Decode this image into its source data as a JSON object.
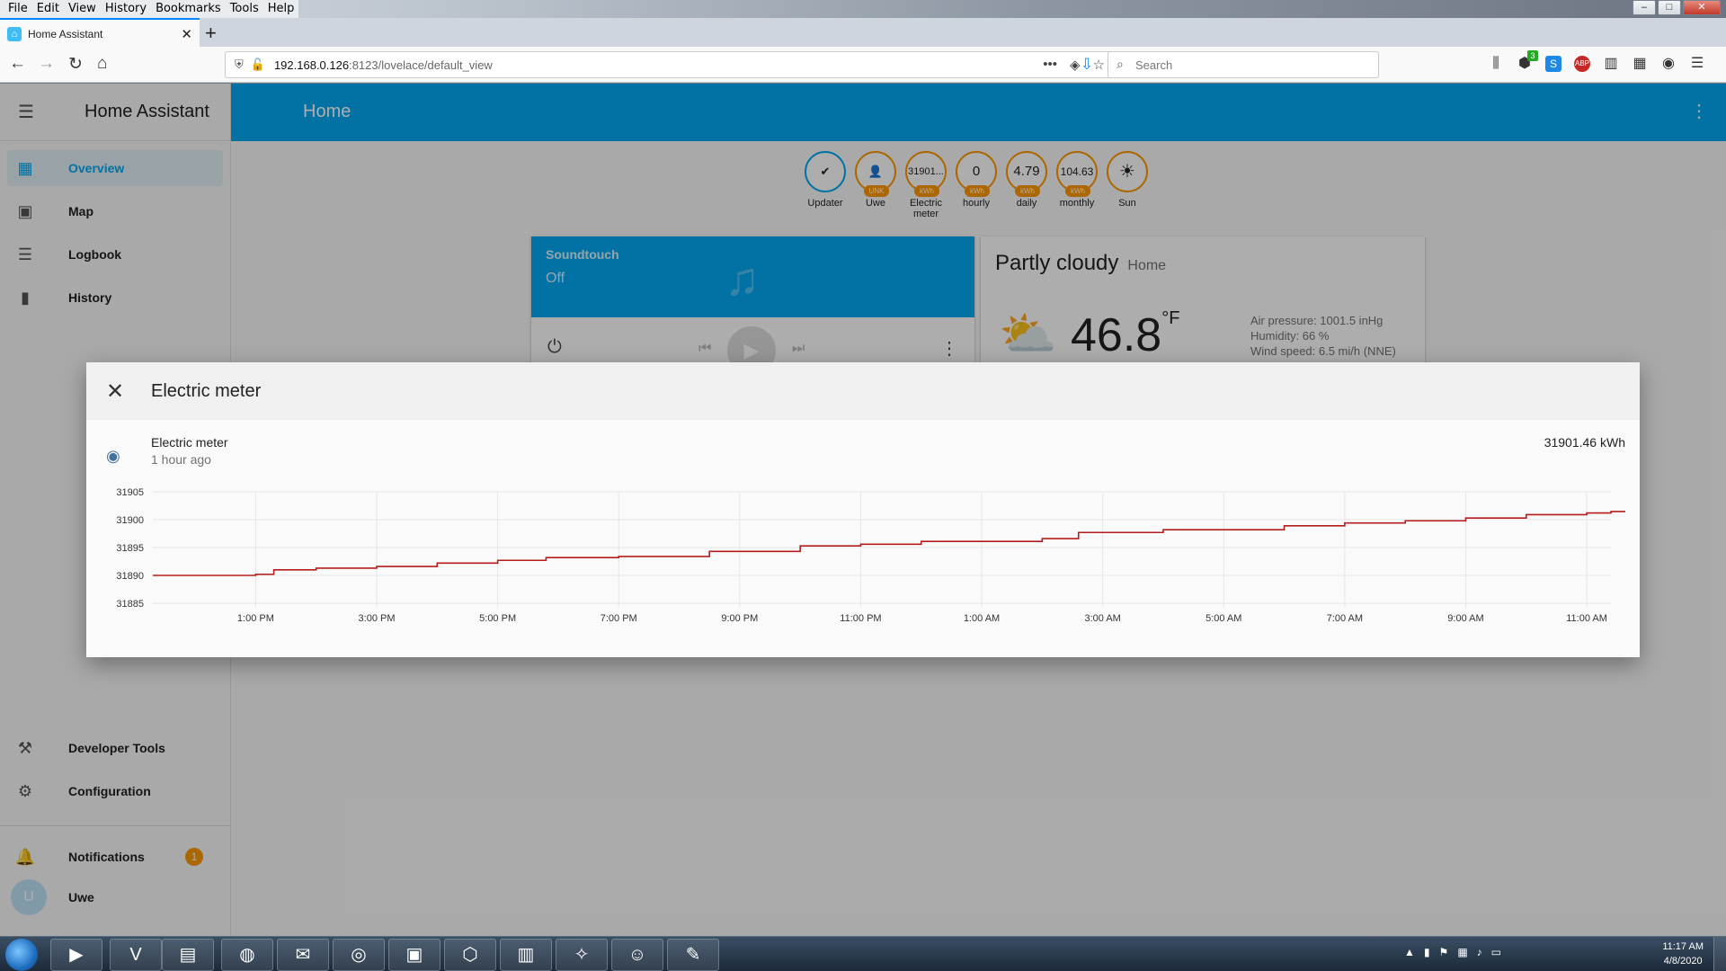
{
  "browser": {
    "menu": [
      "File",
      "Edit",
      "View",
      "History",
      "Bookmarks",
      "Tools",
      "Help"
    ],
    "tab_title": "Home Assistant",
    "url_host": "192.168.0.126",
    "url_path": ":8123/lovelace/default_view",
    "search_placeholder": "Search",
    "toolbar_badge": "3"
  },
  "sidebar": {
    "title": "Home Assistant",
    "items": [
      {
        "label": "Overview",
        "icon": "grid-icon"
      },
      {
        "label": "Map",
        "icon": "map-icon"
      },
      {
        "label": "Logbook",
        "icon": "list-icon"
      },
      {
        "label": "History",
        "icon": "chart-icon"
      }
    ],
    "bottom": [
      {
        "label": "Developer Tools",
        "icon": "hammer-icon"
      },
      {
        "label": "Configuration",
        "icon": "gear-icon"
      }
    ],
    "notifications": {
      "label": "Notifications",
      "count": "1"
    },
    "user": {
      "initial": "U",
      "name": "Uwe"
    }
  },
  "header": {
    "title": "Home"
  },
  "badges": [
    {
      "value": "✔",
      "unit": "",
      "label": "Updater"
    },
    {
      "value": "👤",
      "unit": "UNK",
      "label": "Uwe"
    },
    {
      "value": "31901...",
      "unit": "kWh",
      "label": "Electric meter"
    },
    {
      "value": "0",
      "unit": "kWh",
      "label": "hourly"
    },
    {
      "value": "4.79",
      "unit": "kWh",
      "label": "daily"
    },
    {
      "value": "104.63",
      "unit": "kWh",
      "label": "monthly"
    },
    {
      "value": "☀",
      "unit": "",
      "label": "Sun"
    }
  ],
  "media": {
    "name": "Soundtouch",
    "state": "Off"
  },
  "weather": {
    "condition": "Partly cloudy",
    "location": "Home",
    "temp": "46.8",
    "unit": "°F",
    "pressure": "Air pressure: 1001.5 inHg",
    "humidity": "Humidity: 66 %",
    "wind": "Wind speed: 6.5 mi/h (NNE)"
  },
  "dialog": {
    "title": "Electric meter",
    "entity_name": "Electric meter",
    "entity_time": "1 hour ago",
    "entity_state": "31901.46 kWh"
  },
  "chart_data": {
    "type": "line",
    "x_ticks": [
      "1:00 PM",
      "3:00 PM",
      "5:00 PM",
      "7:00 PM",
      "9:00 PM",
      "11:00 PM",
      "1:00 AM",
      "3:00 AM",
      "5:00 AM",
      "7:00 AM",
      "9:00 AM",
      "11:00 AM"
    ],
    "y_ticks": [
      31905,
      31900,
      31895,
      31890,
      31885
    ],
    "ylim": [
      31885,
      31905
    ],
    "x_hours": [
      11.3,
      13,
      13.3,
      14,
      15,
      16,
      17,
      17.8,
      19,
      20.5,
      22,
      23,
      24,
      26,
      26.6,
      28,
      29,
      30,
      31,
      32,
      33,
      34,
      35,
      35.4
    ],
    "y": [
      31890.0,
      31890.2,
      31891.0,
      31891.3,
      31891.6,
      31892.2,
      31892.7,
      31893.2,
      31893.4,
      31894.3,
      31895.3,
      31895.6,
      31896.1,
      31896.6,
      31897.7,
      31898.2,
      31898.2,
      31898.9,
      31899.4,
      31899.8,
      31900.3,
      31900.9,
      31901.2,
      31901.46
    ],
    "xlabel": "",
    "ylabel": ""
  },
  "taskbar": {
    "apps": [
      "media-player",
      "vim",
      "file-explorer",
      "firefox",
      "thunderbird",
      "chrome",
      "terminal",
      "virtualbox",
      "monitor",
      "tool",
      "gimp",
      "paint"
    ],
    "time": "11:17 AM",
    "date": "4/8/2020"
  }
}
